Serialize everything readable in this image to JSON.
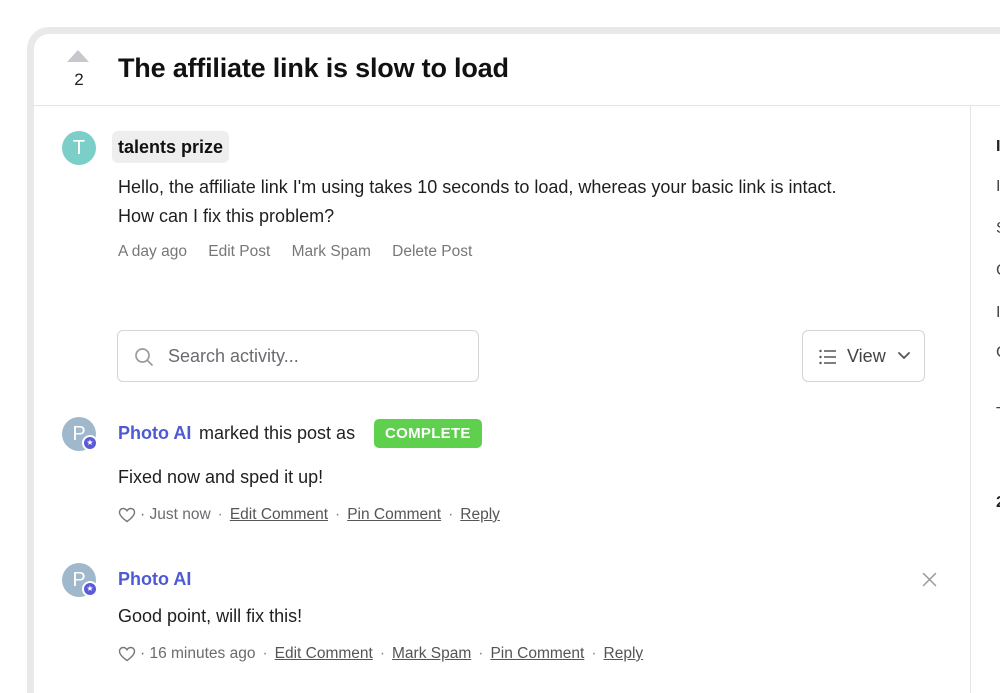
{
  "post": {
    "vote_count": "2",
    "title": "The affiliate link is slow to load",
    "author_initial": "T",
    "author": "talents prize",
    "body_line1": "Hello, the affiliate link I'm using takes 10 seconds to load, whereas your basic link is intact.",
    "body_line2": "How can I fix this problem?",
    "timestamp": "A day ago",
    "actions": {
      "edit": "Edit Post",
      "spam": "Mark Spam",
      "delete": "Delete Post"
    }
  },
  "search": {
    "placeholder": "Search activity..."
  },
  "view_button": {
    "label": "View"
  },
  "activities": [
    {
      "avatar_initial": "P",
      "name": "Photo AI",
      "action_text": "marked this post as",
      "status": "COMPLETE",
      "body": "Fixed now and sped it up!",
      "time": "· Just now",
      "links": {
        "edit": "Edit Comment",
        "pin": "Pin Comment",
        "reply": "Reply"
      }
    },
    {
      "avatar_initial": "P",
      "name": "Photo AI",
      "body": "Good point, will fix this!",
      "time": "· 16 minutes ago",
      "links": {
        "edit": "Edit Comment",
        "spam": "Mark Spam",
        "pin": "Pin Comment",
        "reply": "Reply"
      }
    }
  ],
  "sidebar_partial_letters": [
    "I",
    "I",
    "S",
    "C",
    "I",
    "C",
    "T",
    "2"
  ],
  "colors": {
    "accent": "#4d5ad4",
    "complete": "#5fcf4e",
    "teal_avatar": "#7ccfc8"
  },
  "icons": [
    "upvote-arrow-icon",
    "search-icon",
    "list-icon",
    "chevron-down-icon",
    "heart-icon",
    "close-icon",
    "star-badge-icon"
  ]
}
